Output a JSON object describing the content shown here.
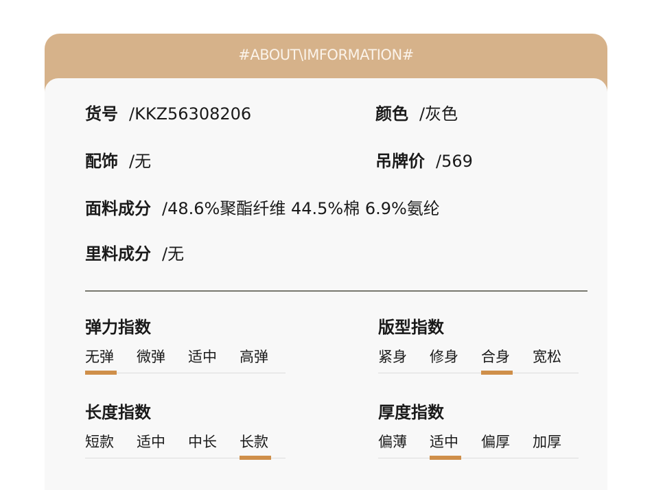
{
  "header": {
    "title": "#ABOUT\\IMFORMATION#"
  },
  "info": {
    "item_no": {
      "label": "货号",
      "value": "/KKZ56308206"
    },
    "color": {
      "label": "颜色",
      "value": "/灰色"
    },
    "accessory": {
      "label": "配饰",
      "value": "/无"
    },
    "tag_price": {
      "label": "吊牌价",
      "value": "/569"
    },
    "fabric": {
      "label": "面料成分",
      "value": "/48.6%聚酯纤维 44.5%棉 6.9%氨纶"
    },
    "lining": {
      "label": "里料成分",
      "value": "/无"
    }
  },
  "indices": {
    "elasticity": {
      "title": "弹力指数",
      "options": [
        "无弹",
        "微弹",
        "适中",
        "高弹"
      ],
      "selected": 0
    },
    "fit": {
      "title": "版型指数",
      "options": [
        "紧身",
        "修身",
        "合身",
        "宽松"
      ],
      "selected": 2
    },
    "length": {
      "title": "长度指数",
      "options": [
        "短款",
        "适中",
        "中长",
        "长款"
      ],
      "selected": 3
    },
    "thickness": {
      "title": "厚度指数",
      "options": [
        "偏薄",
        "适中",
        "偏厚",
        "加厚"
      ],
      "selected": 1
    }
  },
  "colors": {
    "header_bg": "#d6b28a",
    "panel_bg": "#f8f8f8",
    "accent": "#cf8f4a",
    "divider": "#77776e"
  }
}
